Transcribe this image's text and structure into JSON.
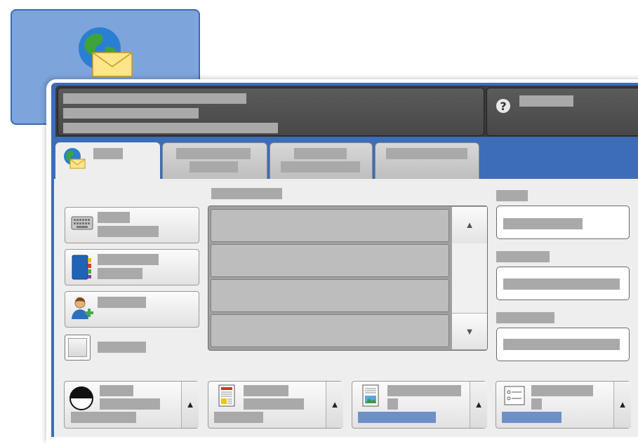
{
  "app": {
    "icon": "globe-envelope-icon"
  },
  "colors": {
    "panel_blue": "#3d6cb9",
    "tile_blue": "#7ea4dc",
    "header_dark": "#3a3a3a",
    "redacted_bar": "#a9a9a9",
    "accent_bar": "#6d90c7"
  },
  "icons": {
    "help": "question-mark-icon",
    "keyboard": "keyboard-icon",
    "address_book": "address-book-icon",
    "add_recipient": "add-person-icon",
    "color_mode": "half-circle-icon",
    "document": "document-icon",
    "image": "picture-icon",
    "options": "list-options-icon",
    "scroll_up": "up-arrow-icon",
    "scroll_down": "down-arrow-icon"
  },
  "scroll": {
    "up": "▲",
    "down": "▼"
  },
  "bottom_arrow": "▲"
}
